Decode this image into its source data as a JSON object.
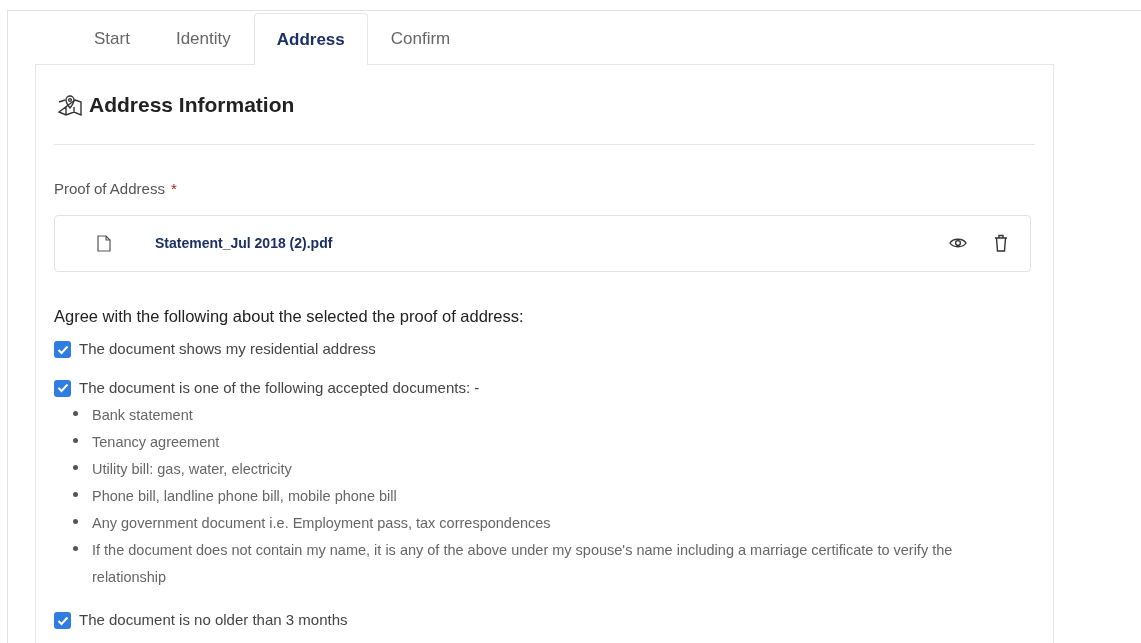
{
  "tabs": [
    {
      "label": "Start",
      "selected": false
    },
    {
      "label": "Identity",
      "selected": false
    },
    {
      "label": "Address",
      "selected": true
    },
    {
      "label": "Confirm",
      "selected": false
    }
  ],
  "section": {
    "title": "Address Information"
  },
  "field": {
    "label": "Proof of Address",
    "required": true,
    "required_mark": "*",
    "file": {
      "name": "Statement_Jul 2018 (2).pdf"
    }
  },
  "agreement": {
    "heading": "Agree with the following about the selected the proof of address:",
    "items": [
      {
        "label": "The document shows my residential address",
        "checked": true
      },
      {
        "label": "The document is one of the following accepted documents: -",
        "checked": true,
        "bullets": [
          "Bank statement",
          "Tenancy agreement",
          "Utility bill: gas, water, electricity",
          "Phone bill, landline phone bill, mobile phone bill",
          "Any government document i.e. Employment pass, tax correspondences",
          "If the document does not contain my name, it is any of the above under my spouse's name including a marriage certificate to verify the relationship"
        ]
      },
      {
        "label": "The document is no older than 3 months",
        "checked": true
      }
    ]
  }
}
